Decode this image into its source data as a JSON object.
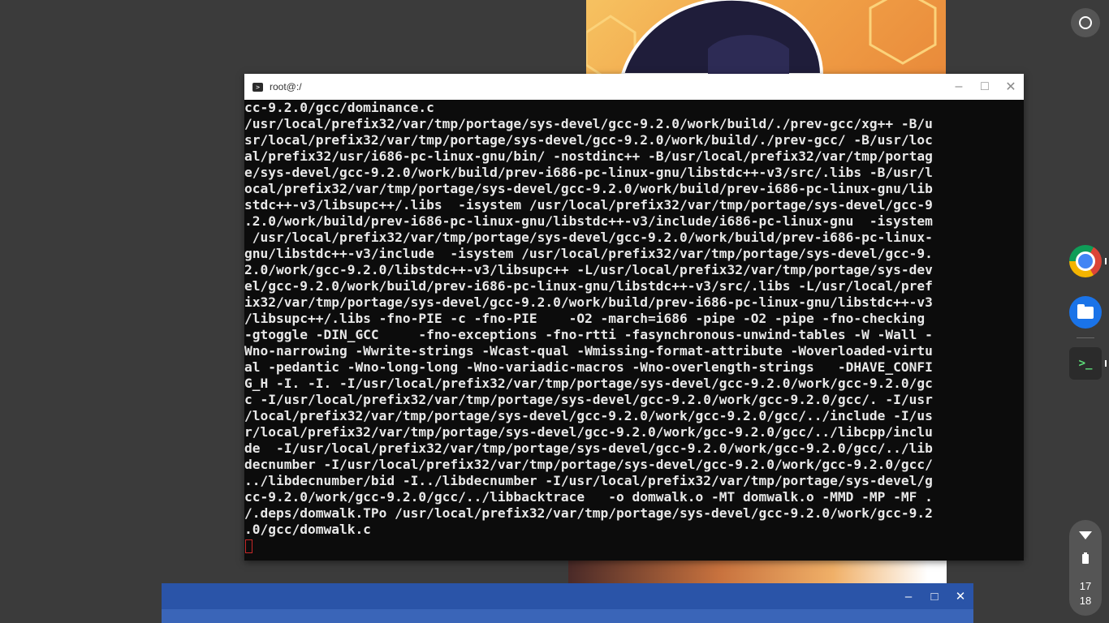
{
  "terminal": {
    "title": "root@:/",
    "lines": [
      "cc-9.2.0/gcc/dominance.c",
      "/usr/local/prefix32/var/tmp/portage/sys-devel/gcc-9.2.0/work/build/./prev-gcc/xg++ -B/u",
      "sr/local/prefix32/var/tmp/portage/sys-devel/gcc-9.2.0/work/build/./prev-gcc/ -B/usr/loc",
      "al/prefix32/usr/i686-pc-linux-gnu/bin/ -nostdinc++ -B/usr/local/prefix32/var/tmp/portag",
      "e/sys-devel/gcc-9.2.0/work/build/prev-i686-pc-linux-gnu/libstdc++-v3/src/.libs -B/usr/l",
      "ocal/prefix32/var/tmp/portage/sys-devel/gcc-9.2.0/work/build/prev-i686-pc-linux-gnu/lib",
      "stdc++-v3/libsupc++/.libs  -isystem /usr/local/prefix32/var/tmp/portage/sys-devel/gcc-9",
      ".2.0/work/build/prev-i686-pc-linux-gnu/libstdc++-v3/include/i686-pc-linux-gnu  -isystem",
      " /usr/local/prefix32/var/tmp/portage/sys-devel/gcc-9.2.0/work/build/prev-i686-pc-linux-",
      "gnu/libstdc++-v3/include  -isystem /usr/local/prefix32/var/tmp/portage/sys-devel/gcc-9.",
      "2.0/work/gcc-9.2.0/libstdc++-v3/libsupc++ -L/usr/local/prefix32/var/tmp/portage/sys-dev",
      "el/gcc-9.2.0/work/build/prev-i686-pc-linux-gnu/libstdc++-v3/src/.libs -L/usr/local/pref",
      "ix32/var/tmp/portage/sys-devel/gcc-9.2.0/work/build/prev-i686-pc-linux-gnu/libstdc++-v3",
      "/libsupc++/.libs -fno-PIE -c -fno-PIE    -O2 -march=i686 -pipe -O2 -pipe -fno-checking ",
      "-gtoggle -DIN_GCC     -fno-exceptions -fno-rtti -fasynchronous-unwind-tables -W -Wall -",
      "Wno-narrowing -Wwrite-strings -Wcast-qual -Wmissing-format-attribute -Woverloaded-virtu",
      "al -pedantic -Wno-long-long -Wno-variadic-macros -Wno-overlength-strings   -DHAVE_CONFI",
      "G_H -I. -I. -I/usr/local/prefix32/var/tmp/portage/sys-devel/gcc-9.2.0/work/gcc-9.2.0/gc",
      "c -I/usr/local/prefix32/var/tmp/portage/sys-devel/gcc-9.2.0/work/gcc-9.2.0/gcc/. -I/usr",
      "/local/prefix32/var/tmp/portage/sys-devel/gcc-9.2.0/work/gcc-9.2.0/gcc/../include -I/us",
      "r/local/prefix32/var/tmp/portage/sys-devel/gcc-9.2.0/work/gcc-9.2.0/gcc/../libcpp/inclu",
      "de  -I/usr/local/prefix32/var/tmp/portage/sys-devel/gcc-9.2.0/work/gcc-9.2.0/gcc/../lib",
      "decnumber -I/usr/local/prefix32/var/tmp/portage/sys-devel/gcc-9.2.0/work/gcc-9.2.0/gcc/",
      "../libdecnumber/bid -I../libdecnumber -I/usr/local/prefix32/var/tmp/portage/sys-devel/g",
      "cc-9.2.0/work/gcc-9.2.0/gcc/../libbacktrace   -o domwalk.o -MT domwalk.o -MMD -MP -MF .",
      "/.deps/domwalk.TPo /usr/local/prefix32/var/tmp/portage/sys-devel/gcc-9.2.0/work/gcc-9.2",
      ".0/gcc/domwalk.c"
    ]
  },
  "shelf": {
    "apps": [
      {
        "name": "chrome",
        "icon": "chrome-icon"
      },
      {
        "name": "files",
        "icon": "folder-icon"
      },
      {
        "name": "terminal",
        "icon": "terminal-icon",
        "glyph": ">_"
      }
    ],
    "clock": {
      "hour": "17",
      "minute": "18"
    }
  },
  "icons": {
    "minimize": "–",
    "maximize": "□",
    "close": "✕"
  },
  "colors": {
    "terminal_bg": "#0c0c0c",
    "terminal_text": "#e8e8e8",
    "cursor": "#c62828",
    "blue_window": "#2a54a8",
    "shelf_bg": "#3b3b3b"
  }
}
